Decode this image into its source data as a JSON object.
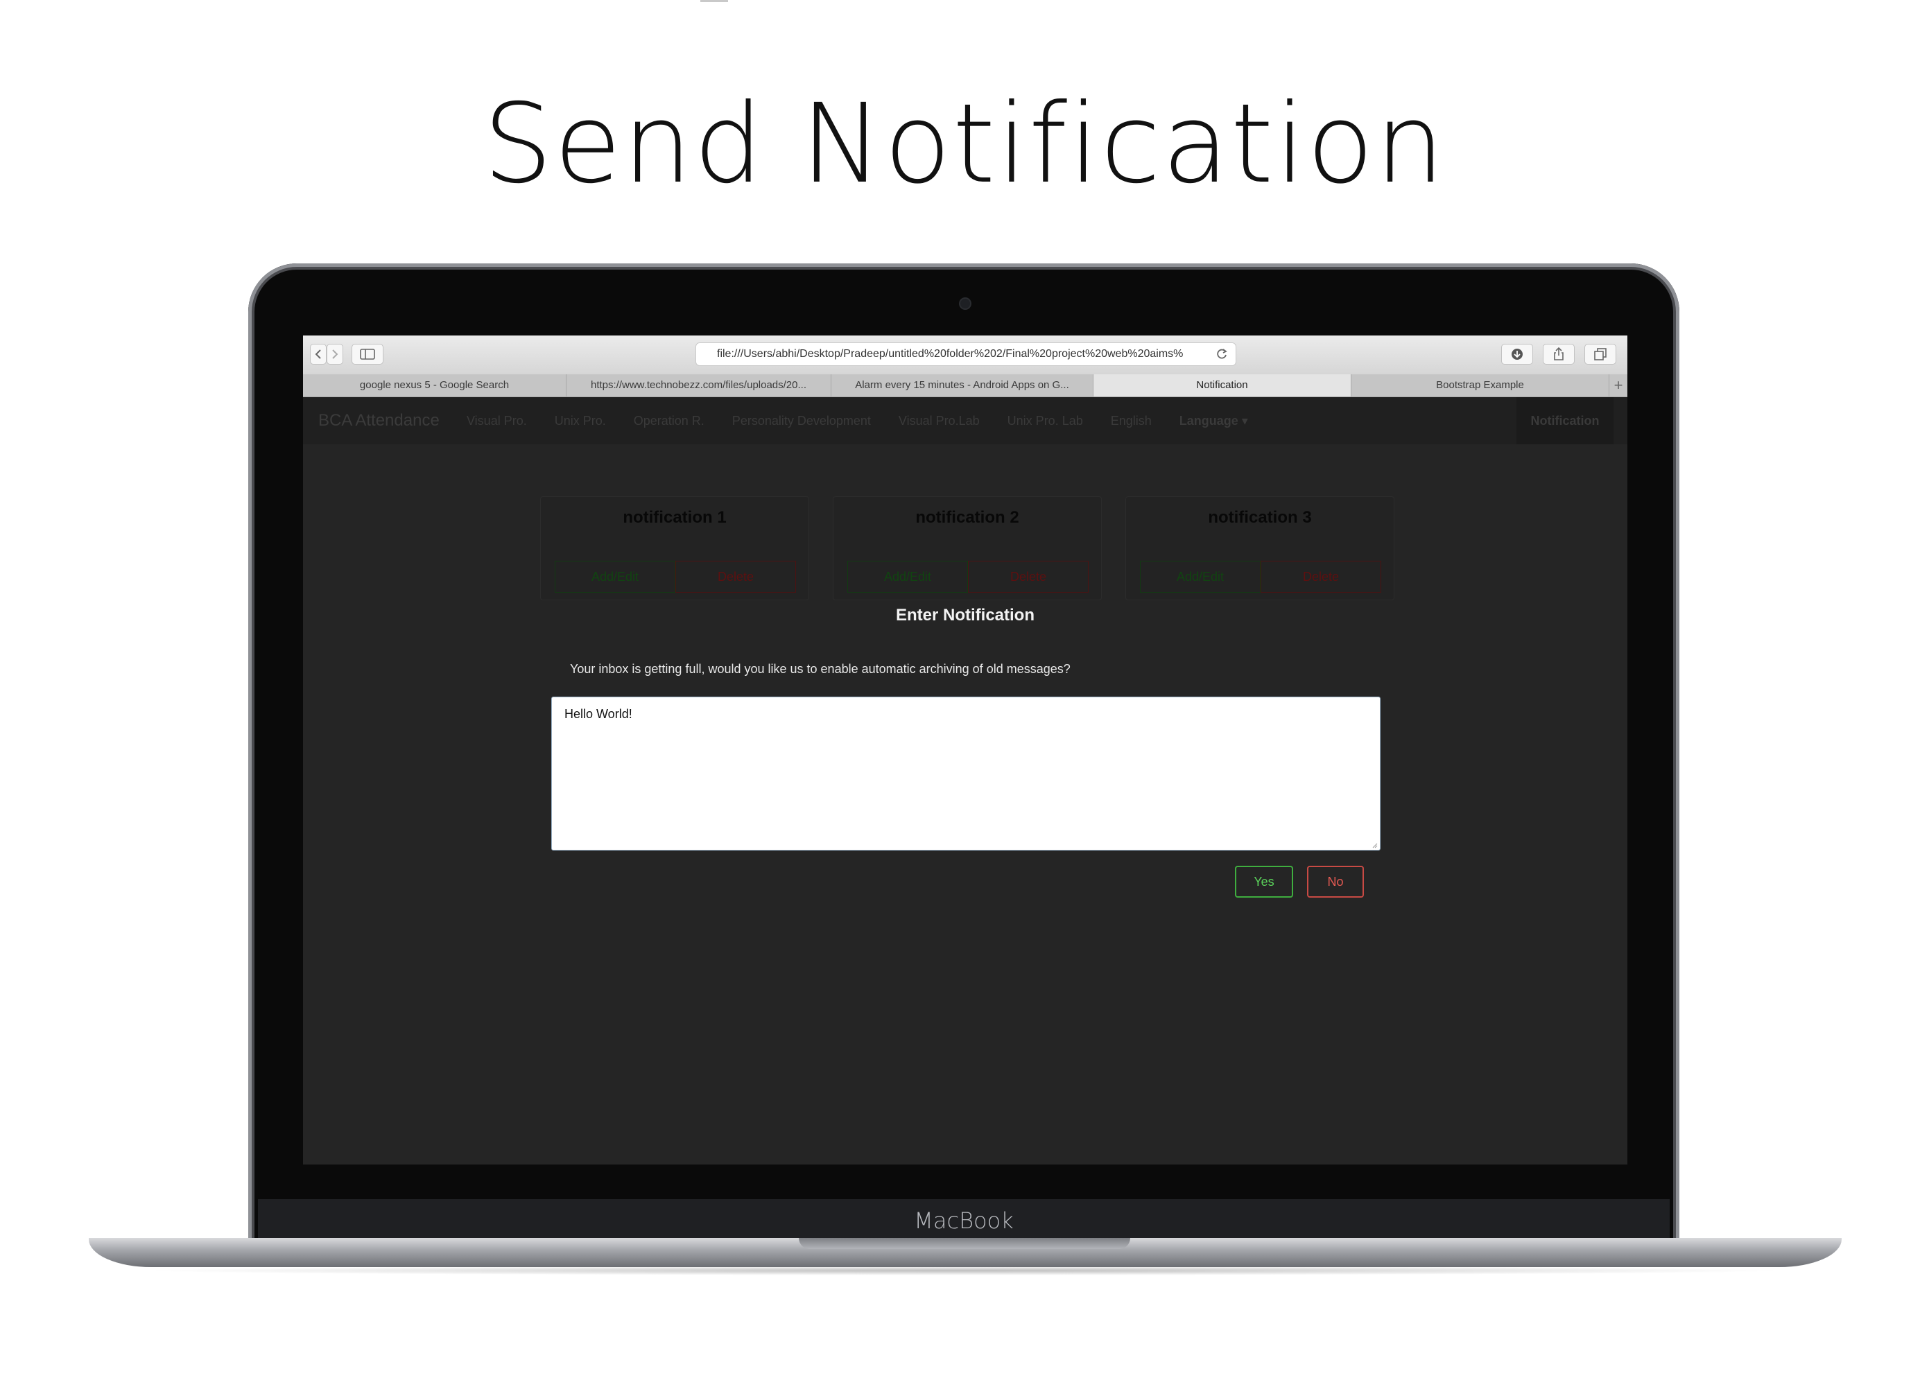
{
  "page": {
    "title": "Send Notification",
    "device_label": "MacBook"
  },
  "browser": {
    "url": "file:///Users/abhi/Desktop/Pradeep/untitled%20folder%202/Final%20project%20web%20aims%",
    "tabs": [
      {
        "label": "google nexus 5 - Google Search",
        "active": false
      },
      {
        "label": "https://www.technobezz.com/files/uploads/20...",
        "active": false
      },
      {
        "label": "Alarm every 15 minutes - Android Apps on G...",
        "active": false
      },
      {
        "label": "Notification",
        "active": true
      },
      {
        "label": "Bootstrap Example",
        "active": false
      }
    ],
    "new_tab_label": "+"
  },
  "navbar": {
    "brand": "BCA Attendance",
    "links": [
      "Visual Pro.",
      "Unix Pro.",
      "Operation R.",
      "Personality Development",
      "Visual Pro.Lab",
      "Unix Pro. Lab",
      "English",
      "Language ▾"
    ],
    "right_item": "Notification"
  },
  "cards": [
    {
      "title": "notification 1",
      "edit_label": "Add/Edit",
      "delete_label": "Delete"
    },
    {
      "title": "notification 2",
      "edit_label": "Add/Edit",
      "delete_label": "Delete"
    },
    {
      "title": "notification 3",
      "edit_label": "Add/Edit",
      "delete_label": "Delete"
    }
  ],
  "modal": {
    "title": "Enter Notification",
    "message": "Your inbox is getting full, would you like us to enable automatic archiving of old messages?",
    "input_value": "Hello World!",
    "yes_label": "Yes",
    "no_label": "No"
  },
  "colors": {
    "screen_bg": "#252525",
    "yes_green": "#3fae3f",
    "no_red": "#c84a44"
  }
}
